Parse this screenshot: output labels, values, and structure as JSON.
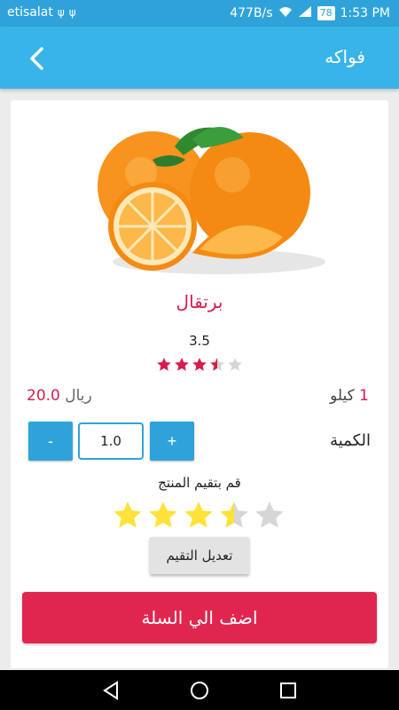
{
  "status_bar": {
    "carrier": "etisalat",
    "network_speed": "477B/s",
    "battery": "78",
    "time": "1:53 PM"
  },
  "app_bar": {
    "title": "فواكه",
    "back_icon": "chevron-left-icon"
  },
  "product": {
    "name": "برتقال",
    "image": "oranges-image",
    "rating_value": "3.5",
    "rating": 3.5,
    "rating_max": 5,
    "unit_number": "1",
    "unit_label": "كيلو",
    "price_value": "20.0",
    "price_currency": "ريال"
  },
  "quantity": {
    "label": "الكمية",
    "value": "1.0",
    "minus_label": "-",
    "plus_label": "+"
  },
  "user_rating": {
    "prompt": "قم بتقيم المنتج",
    "rating": 3.5,
    "rating_max": 5,
    "edit_label": "تعديل التقيم"
  },
  "cart": {
    "add_label": "اضف الي السلة"
  },
  "colors": {
    "primary": "#38b4e8",
    "accent": "#e0264f",
    "star_small": "#d81b4c",
    "star_big": "#fde23a"
  }
}
